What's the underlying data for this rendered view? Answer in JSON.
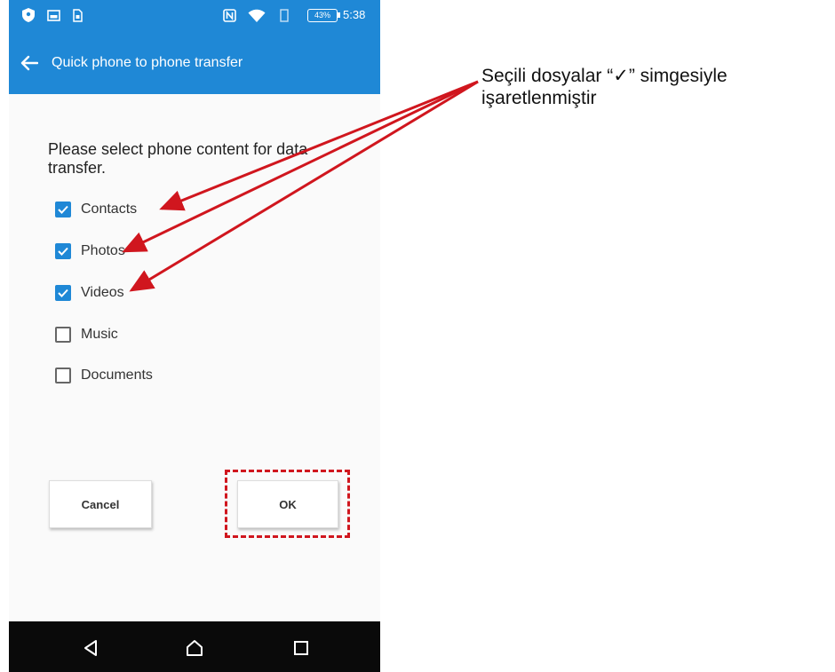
{
  "status_bar": {
    "battery": "43%",
    "time": "5:38"
  },
  "app_bar": {
    "title": "Quick phone to phone transfer"
  },
  "content": {
    "prompt": "Please select phone content for data transfer.",
    "options": [
      {
        "label": "Contacts",
        "checked": true
      },
      {
        "label": "Photos",
        "checked": true
      },
      {
        "label": "Videos",
        "checked": true
      },
      {
        "label": "Music",
        "checked": false
      },
      {
        "label": "Documents",
        "checked": false
      }
    ],
    "cancel_label": "Cancel",
    "ok_label": "OK"
  },
  "annotation": {
    "line1": "Seçili dosyalar “✓” simgesiyle",
    "line2": "işaretlenmiştir",
    "color": "#d0161e"
  },
  "colors": {
    "accent": "#1f88d6",
    "annotation_red": "#d0161e"
  },
  "icons": {
    "back": "arrow-left-icon",
    "nav_back": "triangle-back-icon",
    "nav_home": "home-icon",
    "nav_recents": "square-recents-icon"
  }
}
